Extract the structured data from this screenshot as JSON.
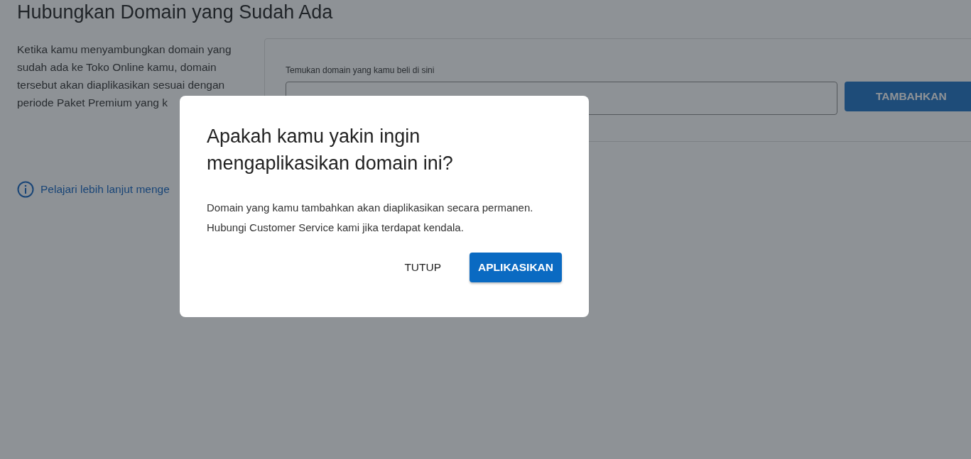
{
  "page": {
    "title": "Hubungkan Domain yang Sudah Ada",
    "description": "Ketika kamu menyambungkan domain yang sudah ada ke Toko Online kamu, domain tersebut akan diaplikasikan sesuai dengan periode Paket Premium yang k",
    "learn_more_link": "Pelajari lebih lanjut menge",
    "domain_form": {
      "label": "Temukan domain yang kamu beli di sini",
      "add_button": "TAMBAHKAN"
    }
  },
  "dialog": {
    "title": "Apakah kamu yakin ingin mengaplikasikan domain ini?",
    "message": "Domain yang kamu tambahkan akan diaplikasikan secara permanen. Hubungi Customer Service kami jika terdapat kendala.",
    "buttons": [
      {
        "label": "TUTUP",
        "kind": "text"
      },
      {
        "label": "APLIKASIKAN",
        "kind": "primary"
      }
    ]
  }
}
